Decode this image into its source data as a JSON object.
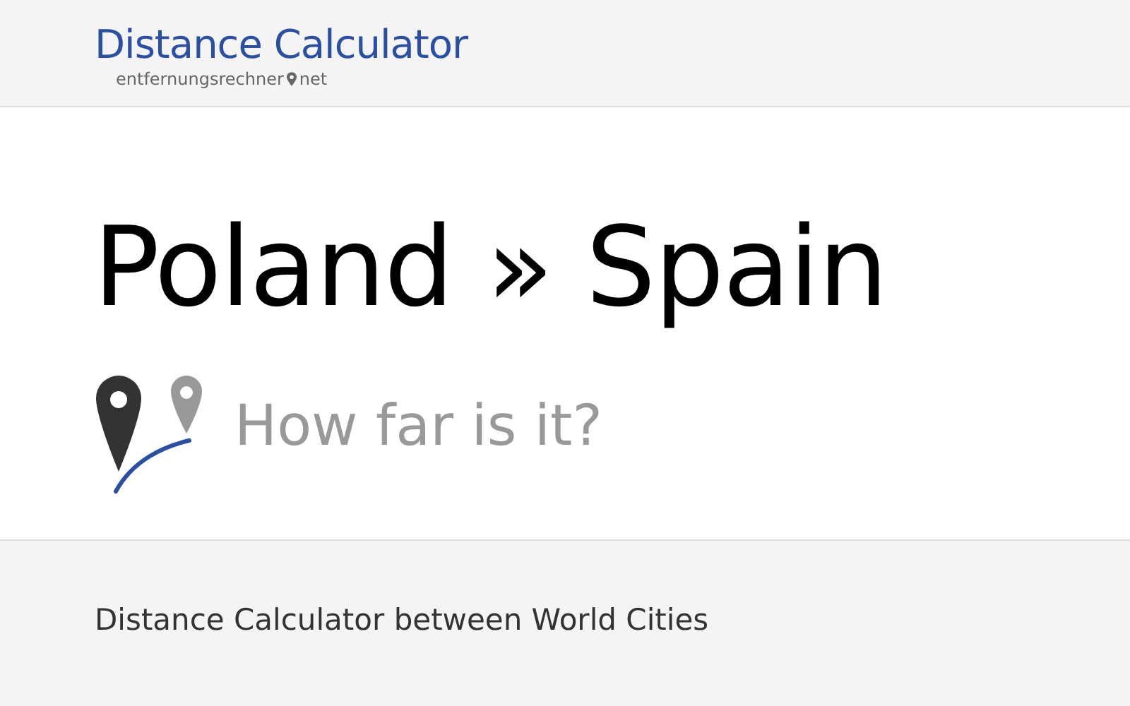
{
  "header": {
    "title": "Distance Calculator",
    "subtitle_left": "entfernungsrechner",
    "subtitle_right": "net"
  },
  "hero": {
    "heading": "Poland » Spain",
    "tagline": "How far is it?"
  },
  "footer": {
    "text": "Distance Calculator between World Cities"
  }
}
